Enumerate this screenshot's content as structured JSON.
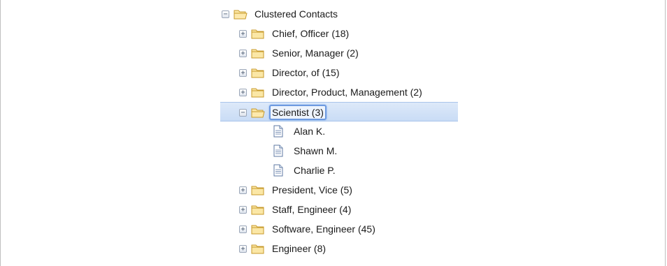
{
  "tree": {
    "root": {
      "label": "Clustered Contacts",
      "toggle": "−",
      "icon": "folder-open-icon"
    },
    "clusters": [
      {
        "label": "Chief, Officer (18)",
        "toggle": "+",
        "icon": "folder-icon"
      },
      {
        "label": "Senior, Manager (2)",
        "toggle": "+",
        "icon": "folder-icon"
      },
      {
        "label": "Director, of (15)",
        "toggle": "+",
        "icon": "folder-icon"
      },
      {
        "label": "Director, Product, Management (2)",
        "toggle": "+",
        "icon": "folder-icon"
      },
      {
        "label": "Scientist (3)",
        "toggle": "−",
        "icon": "folder-open-icon",
        "selected": true,
        "children": [
          {
            "label": "Alan K.",
            "icon": "document-icon"
          },
          {
            "label": "Shawn M.",
            "icon": "document-icon"
          },
          {
            "label": "Charlie P.",
            "icon": "document-icon"
          }
        ]
      },
      {
        "label": "President, Vice (5)",
        "toggle": "+",
        "icon": "folder-icon"
      },
      {
        "label": "Staff, Engineer (4)",
        "toggle": "+",
        "icon": "folder-icon"
      },
      {
        "label": "Software, Engineer (45)",
        "toggle": "+",
        "icon": "folder-icon"
      },
      {
        "label": "Engineer (8)",
        "toggle": "+",
        "icon": "folder-icon"
      }
    ]
  },
  "colors": {
    "folder_fill": "#fbe7a6",
    "folder_stroke": "#c79a2b",
    "document_stroke": "#5f7aa3",
    "selection_band": "#c9dcf5"
  }
}
